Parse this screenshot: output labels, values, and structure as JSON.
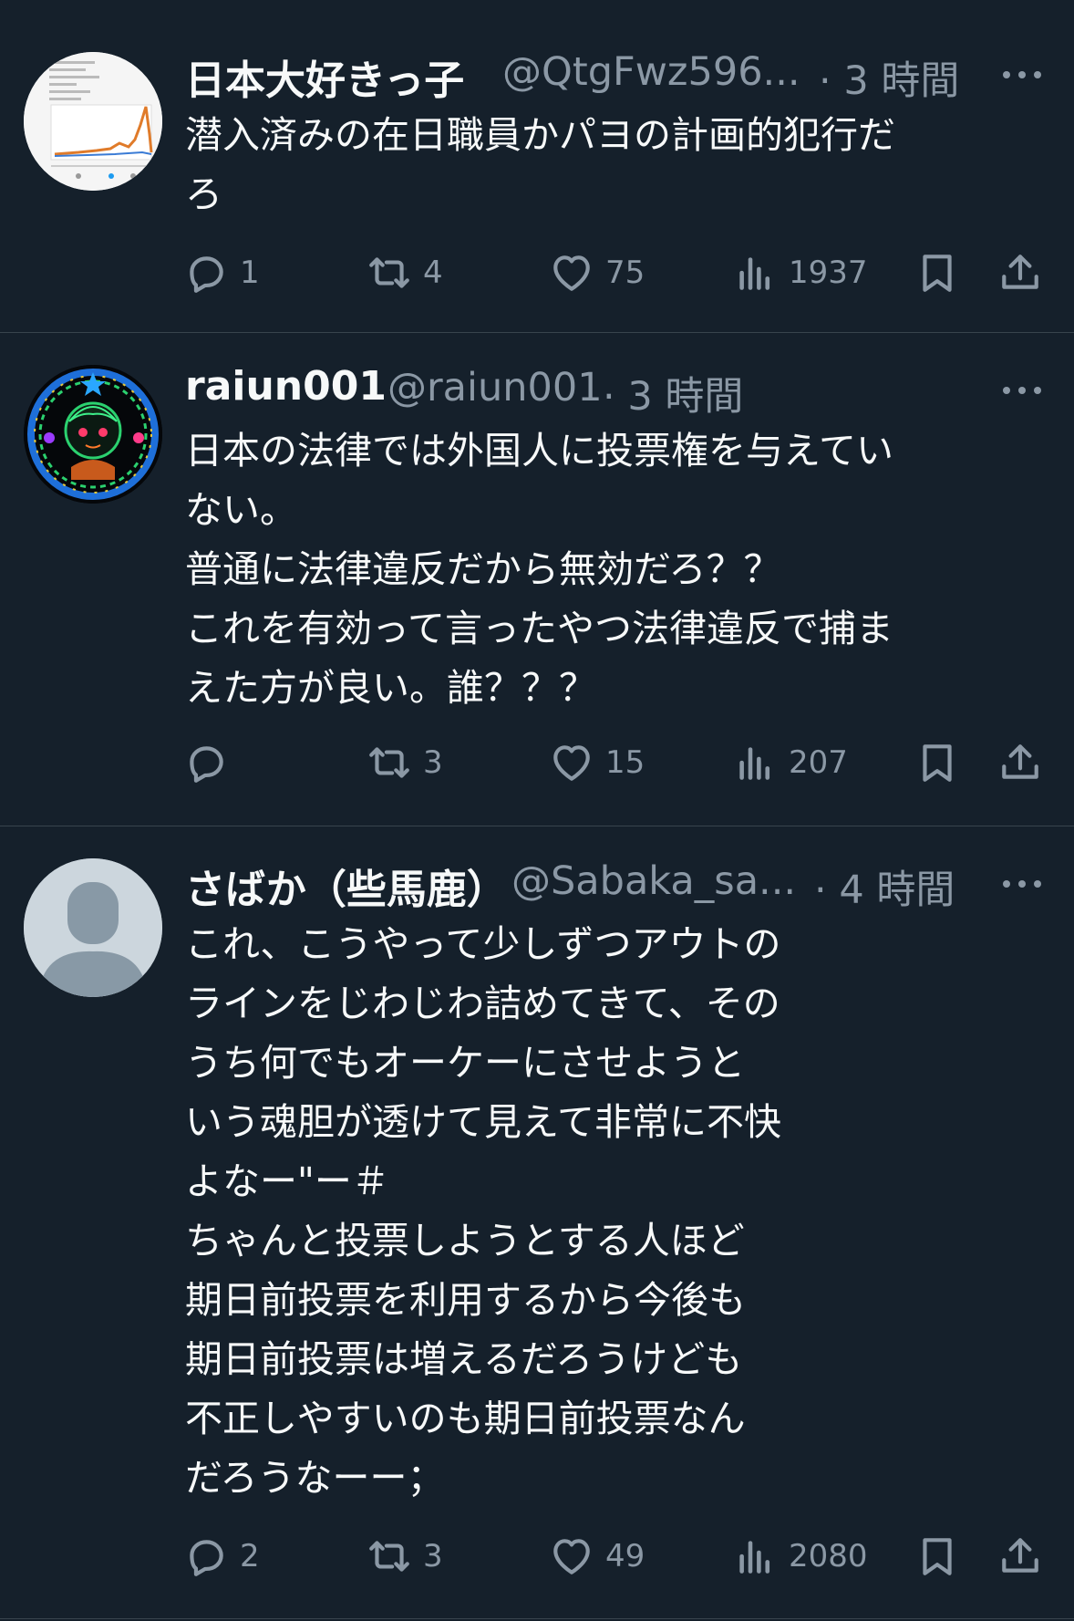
{
  "tweets": [
    {
      "name": "日本大好きっ子",
      "handle": "@QtgFwz596...",
      "time": "· 3 時間",
      "text": "潜入済みの在日職員かパヨの計画的犯行だ\nろ",
      "stats": {
        "replies": "1",
        "retweets": "4",
        "likes": "75",
        "views": "1937"
      }
    },
    {
      "name": "raiun001",
      "handle": "@raiun001",
      "time": "· 3 時間",
      "text": "日本の法律では外国人に投票権を与えてい\nない。\n普通に法律違反だから無効だろ？？\nこれを有効って言ったやつ法律違反で捕ま\nえた方が良い。誰？？？",
      "stats": {
        "replies": "",
        "retweets": "3",
        "likes": "15",
        "views": "207"
      }
    },
    {
      "name": "さばか（些馬鹿）",
      "handle": "@Sabaka_sa...",
      "time": "· 4 時間",
      "text": "これ、こうやって少しずつアウトの\nラインをじわじわ詰めてきて、その\nうち何でもオーケーにさせようと\nいう魂胆が透けて見えて非常に不快\nよなー\"ー＃\nちゃんと投票しようとする人ほど\n期日前投票を利用するから今後も\n期日前投票は増えるだろうけども\n不正しやすいのも期日前投票なん\nだろうなーー；",
      "stats": {
        "replies": "2",
        "retweets": "3",
        "likes": "49",
        "views": "2080"
      }
    }
  ]
}
